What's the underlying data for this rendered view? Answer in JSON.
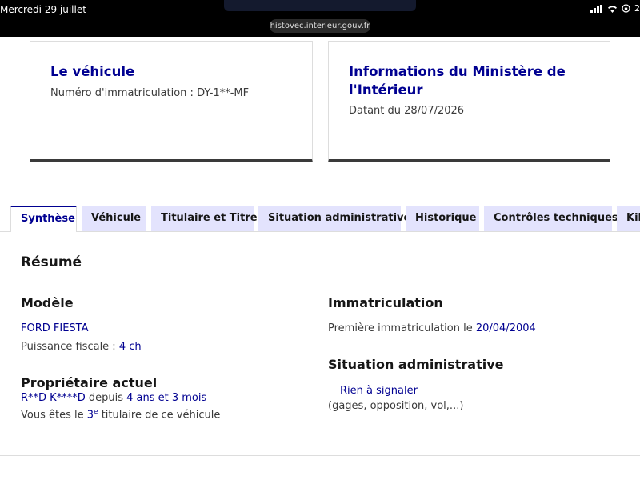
{
  "status_bar": {
    "time": "Mercredi 29 juillet",
    "battery": "2"
  },
  "browser": {
    "url": "histovec.interieur.gouv.fr"
  },
  "cards": {
    "vehicle": {
      "title": "Le véhicule",
      "plate_text": "Numéro d'immatriculation : DY-1**-MF"
    },
    "ministry": {
      "title": "Informations du Ministère de l'Intérieur",
      "date_text": "Datant du 28/07/2026"
    }
  },
  "tabs": [
    {
      "label": "Synthèse",
      "active": true
    },
    {
      "label": "Véhicule",
      "active": false
    },
    {
      "label": "Titulaire et Titre",
      "active": false
    },
    {
      "label": "Situation administrative",
      "active": false
    },
    {
      "label": "Historique",
      "active": false
    },
    {
      "label": "Contrôles techniques",
      "active": false
    },
    {
      "label": "Kil",
      "active": false
    }
  ],
  "summary": {
    "title": "Résumé",
    "model": {
      "heading": "Modèle",
      "name": "FORD FIESTA",
      "power_label": "Puissance fiscale : ",
      "power_value": "4 ch"
    },
    "owner": {
      "heading": "Propriétaire actuel",
      "name": "R**D K****D",
      "since_label": " depuis ",
      "since_value": "4 ans et 3 mois",
      "rank_prefix": "Vous êtes le ",
      "rank_number": "3",
      "rank_sup": "e",
      "rank_suffix": " titulaire de ce véhicule"
    },
    "registration": {
      "heading": "Immatriculation",
      "first_label": "Première immatriculation le ",
      "first_date": "20/04/2004"
    },
    "admin": {
      "heading": "Situation administrative",
      "status": "Rien à signaler",
      "details": "(gages, opposition, vol,...)"
    }
  },
  "colors": {
    "accent": "#000091",
    "tab_bg": "#e3e3fd",
    "text": "#3a3a3a"
  }
}
